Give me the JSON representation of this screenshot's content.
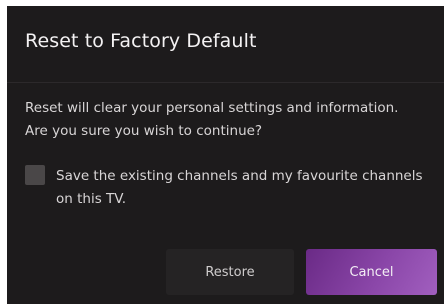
{
  "dialog": {
    "title": "Reset to Factory Default",
    "message": "Reset will clear your personal settings and information. Are you sure you wish to continue?",
    "checkbox": {
      "label": "Save the existing channels and my favourite channels on this TV.",
      "checked": false
    },
    "buttons": {
      "restore_label": "Restore",
      "cancel_label": "Cancel"
    },
    "colors": {
      "background": "#1d1b1c",
      "accent": "#8a46a8"
    }
  }
}
